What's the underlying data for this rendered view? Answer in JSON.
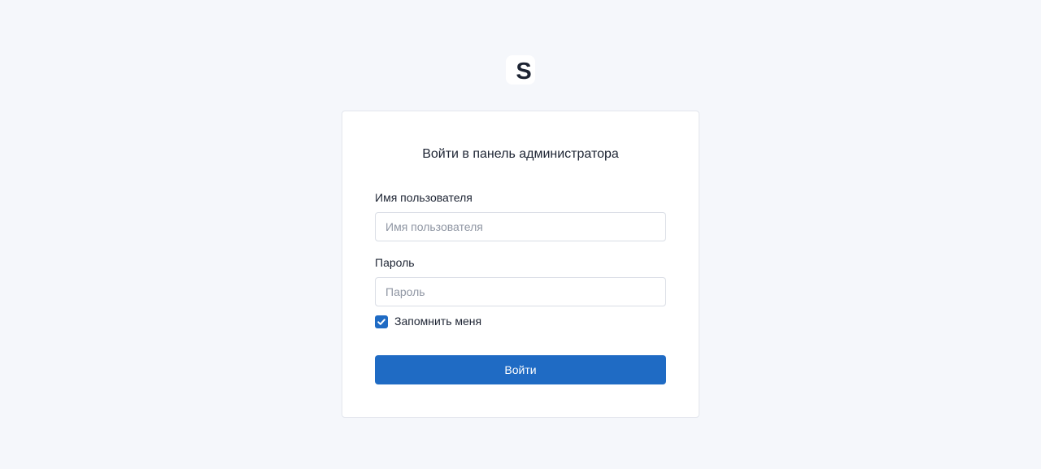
{
  "logo": {
    "letter": "S"
  },
  "login": {
    "title": "Войти в панель администратора",
    "username": {
      "label": "Имя пользователя",
      "placeholder": "Имя пользователя",
      "value": ""
    },
    "password": {
      "label": "Пароль",
      "placeholder": "Пароль",
      "value": ""
    },
    "remember": {
      "label": "Запомнить меня",
      "checked": true
    },
    "submit_label": "Войти"
  },
  "colors": {
    "background": "#f5f7fb",
    "accent": "#1f6bc4",
    "card_border": "#e3e6ed",
    "text": "#1d2433"
  },
  "icons": {
    "checkbox_mark": "check-icon"
  }
}
